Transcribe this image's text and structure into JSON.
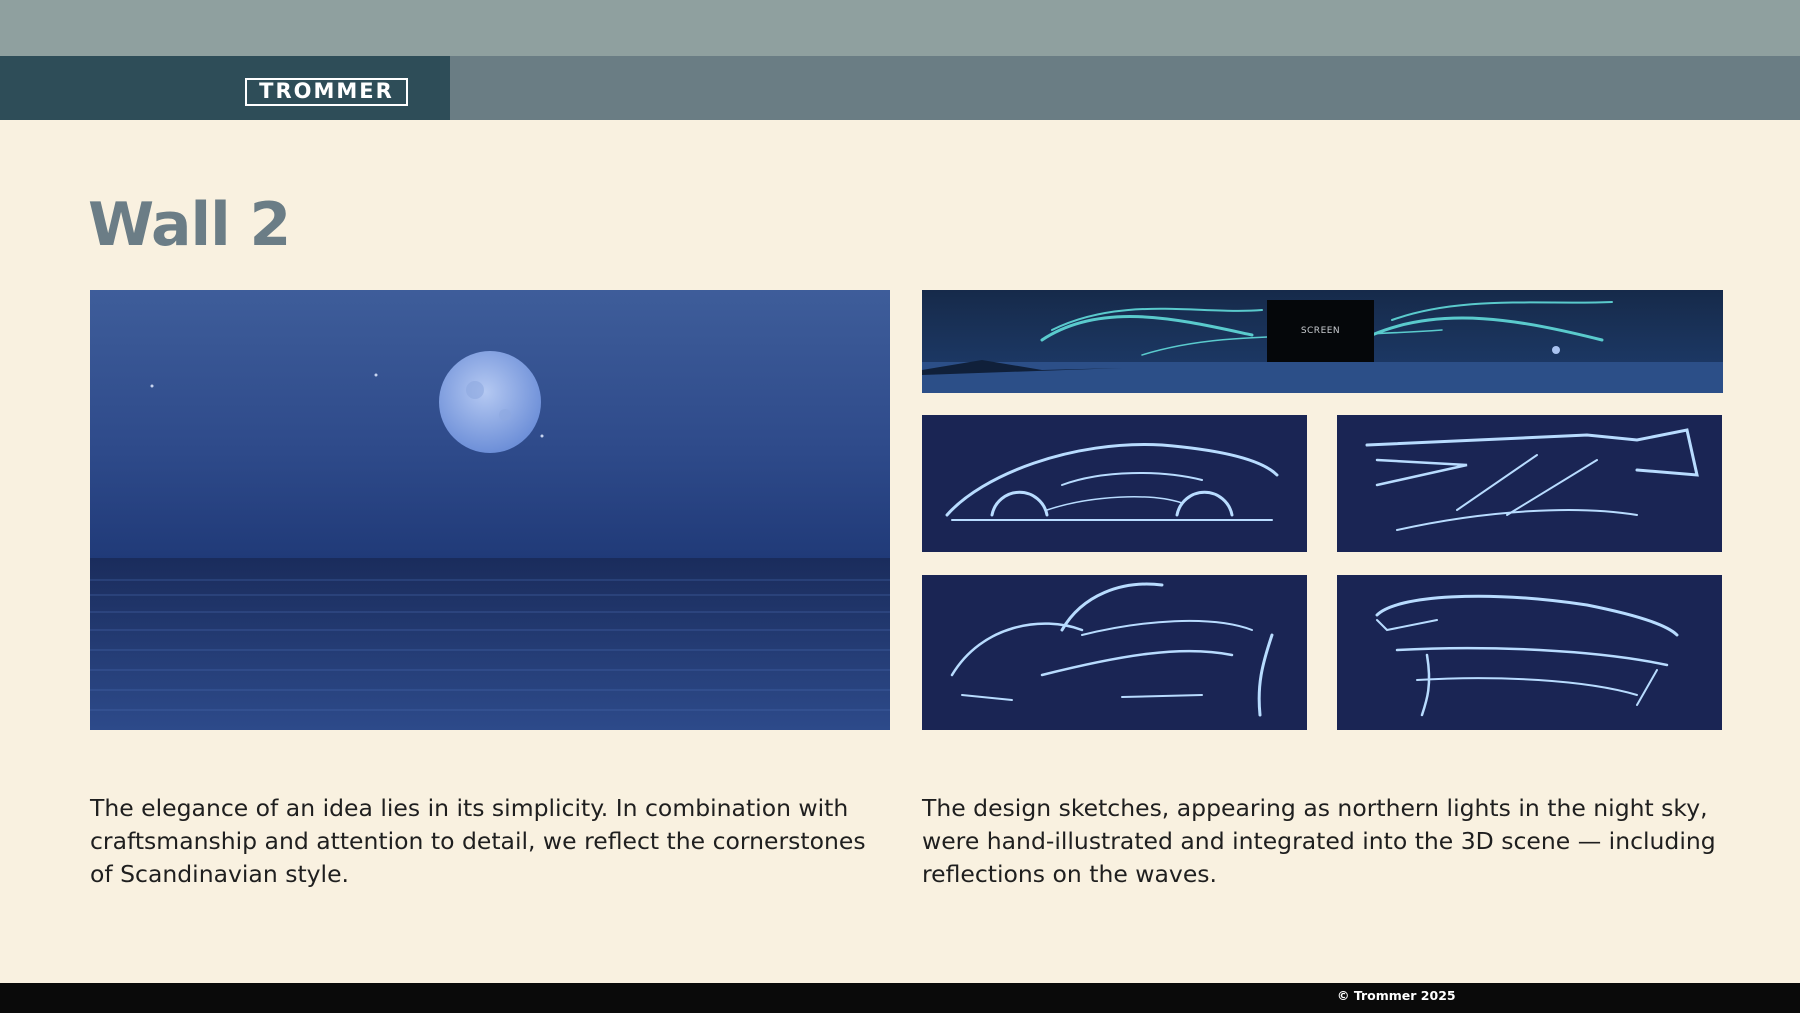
{
  "header": {
    "logo_text": "TROMMER",
    "colors": {
      "top_strip": "#8fa09f",
      "bar": "#6a7d84",
      "logo_block": "#2e4d58"
    }
  },
  "page": {
    "title": "Wall 2"
  },
  "gallery": {
    "wide_panel": {
      "screen_label": "SCREEN"
    },
    "icons": [
      "moon-photo",
      "aurora-panorama",
      "car-sketch",
      "car-sketch",
      "car-sketch",
      "car-sketch"
    ]
  },
  "text": {
    "left_paragraph": "The elegance of an idea lies in its simplicity. In combination with craftsmanship and attention to detail, we reflect the cornerstones of Scandinavian style.",
    "right_paragraph": "The design sketches, appearing as northern lights in the night sky, were hand-illustrated and integrated into the 3D scene — including reflections on the waves."
  },
  "footer": {
    "copyright": "© Trommer 2025"
  }
}
